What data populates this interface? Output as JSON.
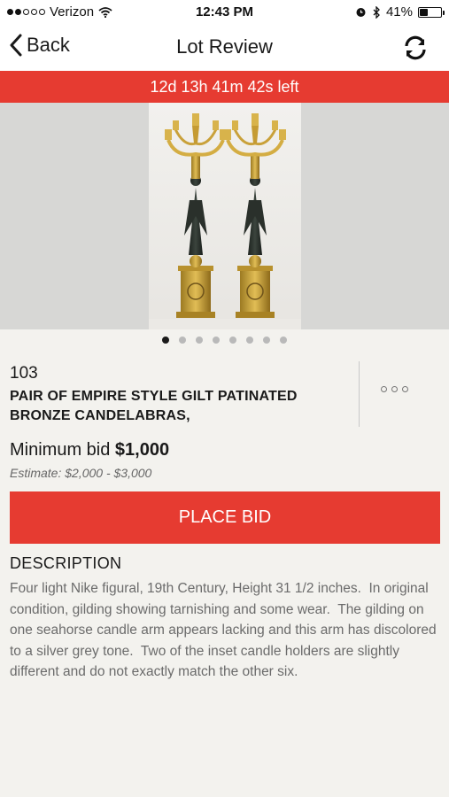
{
  "status_bar": {
    "carrier": "Verizon",
    "time": "12:43 PM",
    "battery": "41%",
    "battery_level": 0.41,
    "signal_bars_filled": 2,
    "signal_bars_total": 5,
    "icons": [
      "wifi-icon",
      "alarm-icon",
      "bluetooth-icon",
      "battery-icon"
    ]
  },
  "nav": {
    "back_label": "Back",
    "title": "Lot Review",
    "refresh_icon": "refresh-icon"
  },
  "timer": {
    "text": "12d 13h 41m 42s left"
  },
  "gallery": {
    "image_subject": "pair of candelabras",
    "total_images": 8,
    "active_index": 0
  },
  "lot": {
    "number": "103",
    "title": "PAIR OF EMPIRE STYLE GILT PATINATED BRONZE CANDELABRAS,",
    "minimum_bid_label": "Minimum bid",
    "minimum_bid_value": "$1,000",
    "estimate": "Estimate: $2,000 - $3,000"
  },
  "actions": {
    "place_bid_label": "PLACE BID"
  },
  "description": {
    "heading": "DESCRIPTION",
    "body": "Four light Nike figural, 19th Century, Height 31 1/2 inches.  In original condition, gilding showing tarnishing and some wear.  The gilding on one seahorse candle arm appears lacking and this arm has discolored to a silver grey tone.  Two of the inset candle holders are slightly different and do not exactly match the other six."
  },
  "colors": {
    "accent_red": "#e63b31",
    "background": "#f3f2ee",
    "text_primary": "#1a1a1a",
    "text_secondary": "#6b6b6b"
  }
}
